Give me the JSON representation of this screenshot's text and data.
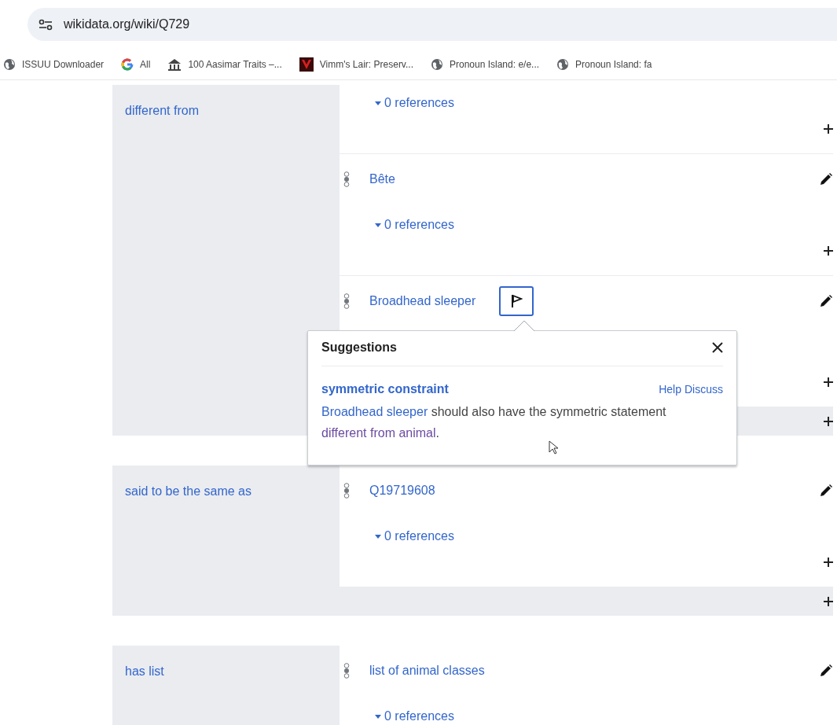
{
  "browser": {
    "address": "wikidata.org/wiki/Q729",
    "bookmarks": [
      {
        "label": "ISSUU Downloader",
        "kind": "globe"
      },
      {
        "label": "All",
        "kind": "google"
      },
      {
        "label": "100 Aasimar Traits –...",
        "kind": "temple"
      },
      {
        "label": "Vimm's Lair: Preserv...",
        "kind": "thumbnail"
      },
      {
        "label": "Pronoun Island: e/e...",
        "kind": "globe"
      },
      {
        "label": "Pronoun Island: fa",
        "kind": "globe"
      }
    ]
  },
  "statement_groups": [
    {
      "property": "different from",
      "add_row": true,
      "statements": [
        {
          "references": "0 references",
          "add_reference": true
        },
        {
          "value": "Bête",
          "references": "0 references",
          "issue_flag": false,
          "add_reference": true
        },
        {
          "value": "Broadhead sleeper",
          "issue_flag": true,
          "add_reference": true
        }
      ]
    },
    {
      "property": "said to be the same as",
      "add_row": true,
      "statements": [
        {
          "value": "Q19719608",
          "references": "0 references",
          "issue_flag": false,
          "add_reference": true
        }
      ]
    },
    {
      "property": "has list",
      "add_row": false,
      "statements": [
        {
          "value": "list of animal classes",
          "references": "0 references",
          "issue_flag": false
        }
      ]
    }
  ],
  "suggestions_popup": {
    "title": "Suggestions",
    "constraint": "symmetric constraint",
    "links": [
      "Help",
      "Discuss"
    ],
    "message": [
      {
        "kind": "link",
        "text": "Broadhead sleeper"
      },
      {
        "kind": "text",
        "text": " should also have the symmetric statement "
      },
      {
        "kind": "visited",
        "text": "different from animal"
      },
      {
        "kind": "text",
        "text": "."
      }
    ]
  }
}
